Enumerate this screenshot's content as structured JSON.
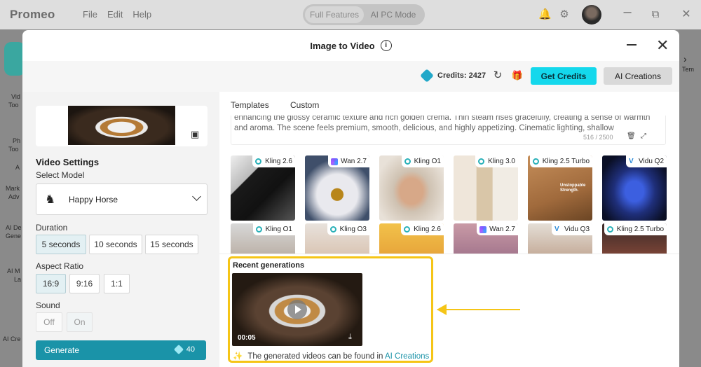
{
  "app": {
    "logo": "Promeo",
    "menu": [
      "File",
      "Edit",
      "Help"
    ],
    "modes": [
      "Full Features",
      "AI PC Mode"
    ]
  },
  "side": {
    "items": [
      "Vid",
      "Too",
      "Ph",
      "Too",
      "A",
      "Mark",
      "Adv",
      "AI De",
      "Gene",
      "AI M",
      "La",
      "AI Cre"
    ],
    "right_label": "Tem"
  },
  "modal": {
    "title": "Image to Video",
    "credits_label": "Credits: 2427",
    "get_credits": "Get Credits",
    "ai_creations": "AI Creations"
  },
  "settings": {
    "title": "Video Settings",
    "select_model_label": "Select Model",
    "model": "Happy Horse",
    "duration_label": "Duration",
    "durations": [
      "5 seconds",
      "10 seconds",
      "15 seconds"
    ],
    "aspect_label": "Aspect Ratio",
    "aspects": [
      "16:9",
      "9:16",
      "1:1"
    ],
    "sound_label": "Sound",
    "sound_opts": [
      "Off",
      "On"
    ],
    "generate": "Generate",
    "generate_cost": "40"
  },
  "tabs": [
    "Templates",
    "Custom"
  ],
  "prompt": {
    "text": "enhancing the glossy ceramic texture and rich golden crema. Thin steam rises gracefully, creating a sense of warmth and aroma. The scene feels premium, smooth, delicious, and highly appetizing. Cinematic lighting, shallow",
    "count": "516 / 2500"
  },
  "templates": [
    {
      "model": "Kling 2.6",
      "icon": "kling"
    },
    {
      "model": "Wan 2.7",
      "icon": "wan"
    },
    {
      "model": "Kling O1",
      "icon": "kling"
    },
    {
      "model": "Kling 3.0",
      "icon": "kling"
    },
    {
      "model": "Kling 2.5 Turbo",
      "icon": "kling"
    },
    {
      "model": "Vidu Q2",
      "icon": "vidu"
    },
    {
      "model": "Kling O1",
      "icon": "kling"
    },
    {
      "model": "Kling O3",
      "icon": "kling"
    },
    {
      "model": "Kling 2.6",
      "icon": "kling"
    },
    {
      "model": "Wan 2.7",
      "icon": "wan"
    },
    {
      "model": "Vidu Q3",
      "icon": "vidu"
    },
    {
      "model": "Kling 2.5 Turbo",
      "icon": "kling"
    }
  ],
  "card5_text": [
    "Unstoppable",
    "Strength."
  ],
  "recent": {
    "title": "Recent generations",
    "duration": "00:05",
    "note_prefix": "The generated videos can be found in ",
    "note_link": "AI Creations"
  },
  "colors": {
    "accent": "#1a93a8",
    "highlight": "#f5c517",
    "get_credits_bg": "#14d8ec"
  }
}
